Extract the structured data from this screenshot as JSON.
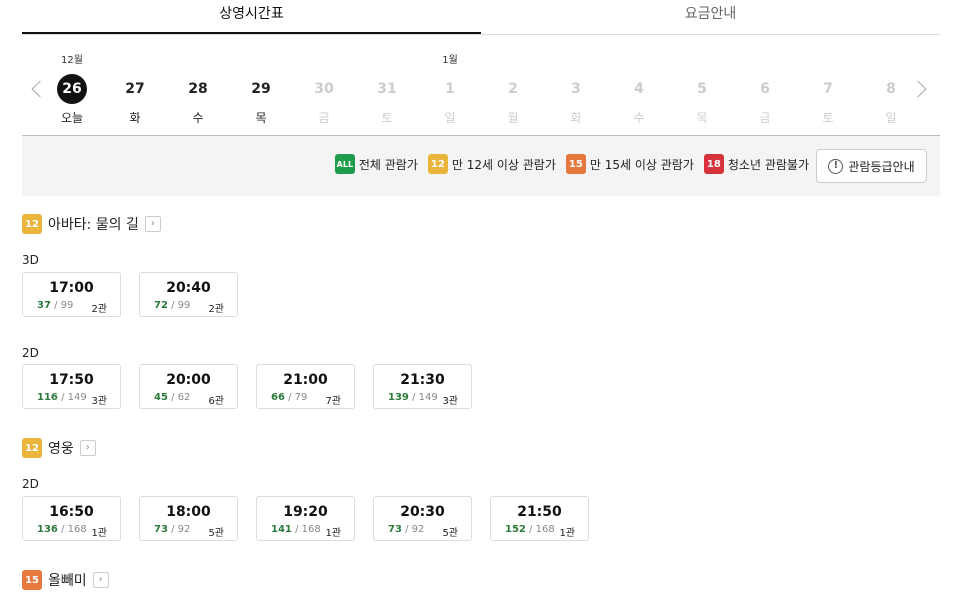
{
  "tabs": [
    {
      "label": "상영시간표"
    },
    {
      "label": "요금안내"
    }
  ],
  "date_bar": {
    "days": [
      {
        "month": "12월",
        "num": "26",
        "weekday": "오늘"
      },
      {
        "month": "",
        "num": "27",
        "weekday": "화"
      },
      {
        "month": "",
        "num": "28",
        "weekday": "수"
      },
      {
        "month": "",
        "num": "29",
        "weekday": "목"
      },
      {
        "month": "",
        "num": "30",
        "weekday": "금"
      },
      {
        "month": "",
        "num": "31",
        "weekday": "토"
      },
      {
        "month": "1월",
        "num": "1",
        "weekday": "일"
      },
      {
        "month": "",
        "num": "2",
        "weekday": "월"
      },
      {
        "month": "",
        "num": "3",
        "weekday": "화"
      },
      {
        "month": "",
        "num": "4",
        "weekday": "수"
      },
      {
        "month": "",
        "num": "5",
        "weekday": "목"
      },
      {
        "month": "",
        "num": "6",
        "weekday": "금"
      },
      {
        "month": "",
        "num": "7",
        "weekday": "토"
      },
      {
        "month": "",
        "num": "8",
        "weekday": "일"
      }
    ]
  },
  "legend": {
    "all": {
      "badge": "ALL",
      "label": "전체 관람가"
    },
    "r12": {
      "badge": "12",
      "label": "만 12세 이상 관람가"
    },
    "r15": {
      "badge": "15",
      "label": "만 15세 이상 관람가"
    },
    "r18": {
      "badge": "18",
      "label": "청소년 관람불가"
    },
    "info_button": "관람등급안내",
    "info_icon_glyph": "!"
  },
  "movies": [
    {
      "rating": "12",
      "title": "아바타: 물의 길",
      "link_glyph": "›",
      "formats": [
        {
          "format": "3D",
          "showtimes": [
            {
              "time": "17:00",
              "remaining": "37",
              "total": "/ 99",
              "hall": "2관"
            },
            {
              "time": "20:40",
              "remaining": "72",
              "total": "/ 99",
              "hall": "2관"
            }
          ]
        },
        {
          "format": "2D",
          "showtimes": [
            {
              "time": "17:50",
              "remaining": "116",
              "total": "/ 149",
              "hall": "3관"
            },
            {
              "time": "20:00",
              "remaining": "45",
              "total": "/ 62",
              "hall": "6관"
            },
            {
              "time": "21:00",
              "remaining": "66",
              "total": "/ 79",
              "hall": "7관"
            },
            {
              "time": "21:30",
              "remaining": "139",
              "total": "/ 149",
              "hall": "3관"
            }
          ]
        }
      ]
    },
    {
      "rating": "12",
      "title": "영웅",
      "link_glyph": "›",
      "formats": [
        {
          "format": "2D",
          "showtimes": [
            {
              "time": "16:50",
              "remaining": "136",
              "total": "/ 168",
              "hall": "1관"
            },
            {
              "time": "18:00",
              "remaining": "73",
              "total": "/ 92",
              "hall": "5관"
            },
            {
              "time": "19:20",
              "remaining": "141",
              "total": "/ 168",
              "hall": "1관"
            },
            {
              "time": "20:30",
              "remaining": "73",
              "total": "/ 92",
              "hall": "5관"
            },
            {
              "time": "21:50",
              "remaining": "152",
              "total": "/ 168",
              "hall": "1관"
            }
          ]
        }
      ]
    },
    {
      "rating": "15",
      "title": "올빼미",
      "link_glyph": "›",
      "formats": []
    }
  ],
  "colors": {
    "rating_all": "#1e9c4b",
    "rating_12": "#e9b53b",
    "rating_15": "#e7793f",
    "rating_18": "#d8323c",
    "remaining_seats": "#2b7a3c"
  }
}
